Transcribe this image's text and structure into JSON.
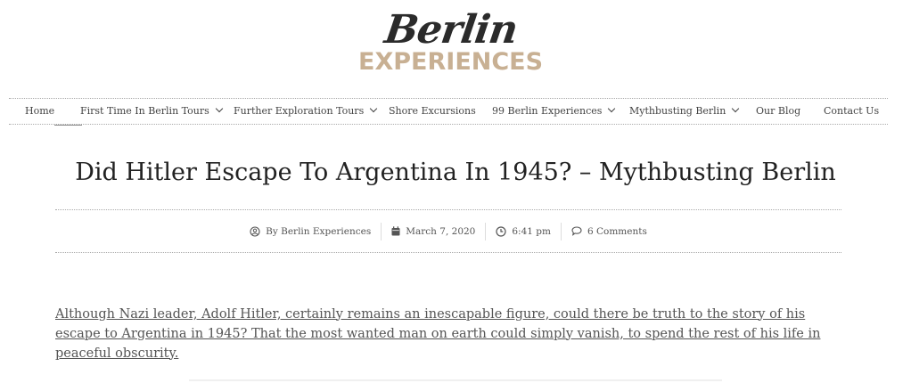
{
  "logo": {
    "script": "Berlin",
    "caps": "EXPERIENCES"
  },
  "nav": {
    "items": [
      {
        "label": "Home"
      },
      {
        "label": "First Time In Berlin Tours"
      },
      {
        "label": "Further Exploration Tours"
      },
      {
        "label": "Shore Excursions"
      },
      {
        "label": "99 Berlin Experiences"
      },
      {
        "label": "Mythbusting Berlin"
      },
      {
        "label": "Our Blog"
      },
      {
        "label": "Contact Us"
      }
    ]
  },
  "post": {
    "title": "Did Hitler Escape To Argentina In 1945? – Mythbusting Berlin",
    "meta": {
      "author": "By Berlin Experiences",
      "date": "March 7, 2020",
      "time": "6:41 pm",
      "comments": "6 Comments"
    },
    "intro": "Although Nazi leader, Adolf Hitler, certainly remains an inescapable figure, could there be truth to the story of his escape to Argentina in 1945? That the most wanted man on earth could simply vanish, to spend the rest of his life in peaceful obscurity."
  },
  "colors": {
    "logo_accent": "#c8b093",
    "text": "#333333"
  }
}
